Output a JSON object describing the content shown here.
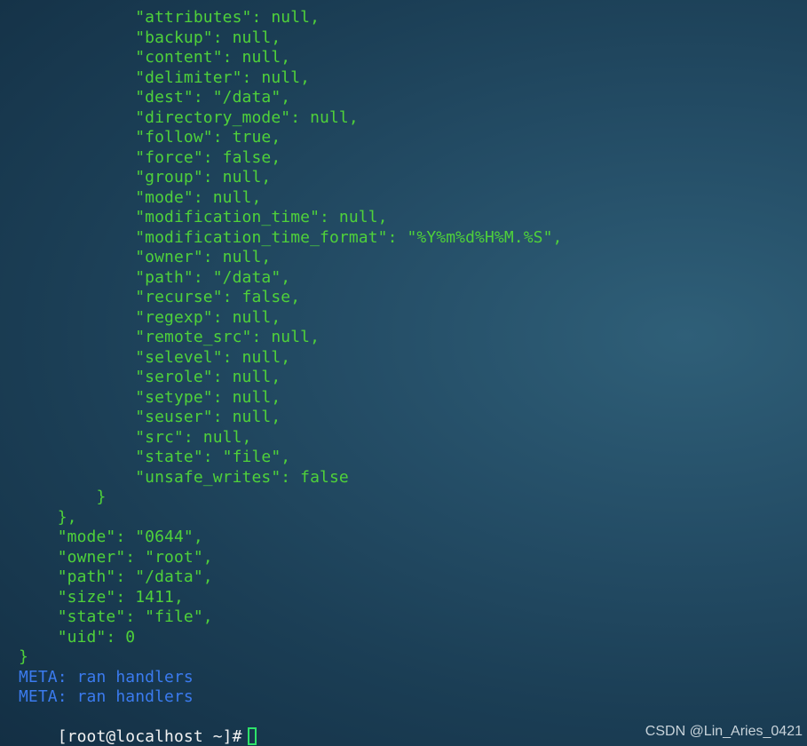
{
  "output_lines": [
    "            \"attributes\": null,",
    "            \"backup\": null,",
    "            \"content\": null,",
    "            \"delimiter\": null,",
    "            \"dest\": \"/data\",",
    "            \"directory_mode\": null,",
    "            \"follow\": true,",
    "            \"force\": false,",
    "            \"group\": null,",
    "            \"mode\": null,",
    "            \"modification_time\": null,",
    "            \"modification_time_format\": \"%Y%m%d%H%M.%S\",",
    "            \"owner\": null,",
    "            \"path\": \"/data\",",
    "            \"recurse\": false,",
    "            \"regexp\": null,",
    "            \"remote_src\": null,",
    "            \"selevel\": null,",
    "            \"serole\": null,",
    "            \"setype\": null,",
    "            \"seuser\": null,",
    "            \"src\": null,",
    "            \"state\": \"file\",",
    "            \"unsafe_writes\": false",
    "        }",
    "    },",
    "    \"mode\": \"0644\",",
    "    \"owner\": \"root\",",
    "    \"path\": \"/data\",",
    "    \"size\": 1411,",
    "    \"state\": \"file\",",
    "    \"uid\": 0",
    "}"
  ],
  "meta_lines": [
    "META: ran handlers",
    "META: ran handlers"
  ],
  "prompt": "[root@localhost ~]#",
  "watermark": "CSDN @Lin_Aries_0421",
  "colors": {
    "json_output": "#4fd13a",
    "meta": "#3b7bef",
    "prompt": "#f2f2f2",
    "cursor": "#2ee36a"
  }
}
